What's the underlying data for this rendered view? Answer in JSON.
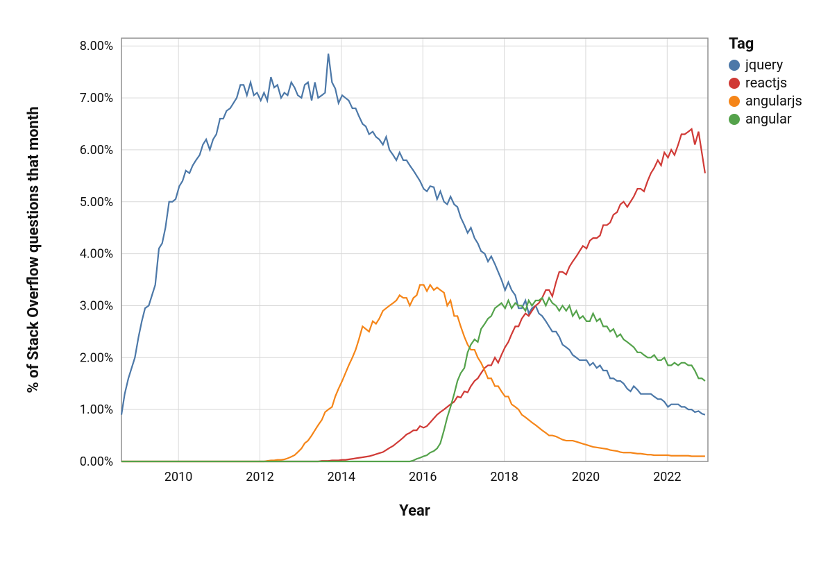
{
  "chart_data": {
    "type": "line",
    "title": "",
    "xlabel": "Year",
    "ylabel": "% of Stack Overflow questions that month",
    "legend_title": "Tag",
    "legend_position": "right",
    "grid": true,
    "x_start": 2008.6,
    "x_end": 2023.0,
    "x_ticks": [
      2010,
      2012,
      2014,
      2016,
      2018,
      2020,
      2022
    ],
    "y_ticks": [
      0,
      1,
      2,
      3,
      4,
      5,
      6,
      7,
      8
    ],
    "y_tick_labels": [
      "0.00%",
      "1.00%",
      "2.00%",
      "3.00%",
      "4.00%",
      "5.00%",
      "6.00%",
      "7.00%",
      "8.00%"
    ],
    "ylim": [
      0,
      8.15
    ],
    "x_tick_labels": [
      "2010",
      "2012",
      "2014",
      "2016",
      "2018",
      "2020",
      "2022"
    ],
    "colors": {
      "jquery": "#4c78a8",
      "reactjs": "#d03a36",
      "angularjs": "#f58518",
      "angular": "#54a24b"
    },
    "x": [
      2008.6,
      2008.68,
      2008.77,
      2008.85,
      2008.93,
      2009.02,
      2009.1,
      2009.18,
      2009.27,
      2009.35,
      2009.43,
      2009.52,
      2009.6,
      2009.68,
      2009.77,
      2009.85,
      2009.93,
      2010.02,
      2010.1,
      2010.18,
      2010.27,
      2010.35,
      2010.43,
      2010.52,
      2010.6,
      2010.68,
      2010.77,
      2010.85,
      2010.93,
      2011.02,
      2011.1,
      2011.18,
      2011.27,
      2011.35,
      2011.43,
      2011.52,
      2011.6,
      2011.68,
      2011.77,
      2011.85,
      2011.93,
      2012.02,
      2012.1,
      2012.18,
      2012.27,
      2012.35,
      2012.43,
      2012.52,
      2012.6,
      2012.68,
      2012.77,
      2012.85,
      2012.93,
      2013.02,
      2013.1,
      2013.18,
      2013.27,
      2013.35,
      2013.43,
      2013.52,
      2013.6,
      2013.68,
      2013.77,
      2013.85,
      2013.93,
      2014.02,
      2014.1,
      2014.18,
      2014.27,
      2014.35,
      2014.43,
      2014.52,
      2014.6,
      2014.68,
      2014.77,
      2014.85,
      2014.93,
      2015.02,
      2015.1,
      2015.18,
      2015.27,
      2015.35,
      2015.43,
      2015.52,
      2015.6,
      2015.68,
      2015.77,
      2015.85,
      2015.93,
      2016.02,
      2016.1,
      2016.18,
      2016.27,
      2016.35,
      2016.43,
      2016.52,
      2016.6,
      2016.68,
      2016.77,
      2016.85,
      2016.93,
      2017.02,
      2017.1,
      2017.18,
      2017.27,
      2017.35,
      2017.43,
      2017.52,
      2017.6,
      2017.68,
      2017.77,
      2017.85,
      2017.93,
      2018.02,
      2018.1,
      2018.18,
      2018.27,
      2018.35,
      2018.43,
      2018.52,
      2018.6,
      2018.68,
      2018.77,
      2018.85,
      2018.93,
      2019.02,
      2019.1,
      2019.18,
      2019.27,
      2019.35,
      2019.43,
      2019.52,
      2019.6,
      2019.68,
      2019.77,
      2019.85,
      2019.93,
      2020.02,
      2020.1,
      2020.18,
      2020.27,
      2020.35,
      2020.43,
      2020.52,
      2020.6,
      2020.68,
      2020.77,
      2020.85,
      2020.93,
      2021.02,
      2021.1,
      2021.18,
      2021.27,
      2021.35,
      2021.43,
      2021.52,
      2021.6,
      2021.68,
      2021.77,
      2021.85,
      2021.93,
      2022.02,
      2022.1,
      2022.18,
      2022.27,
      2022.35,
      2022.43,
      2022.52,
      2022.6,
      2022.68,
      2022.77,
      2022.85,
      2022.93
    ],
    "series": [
      {
        "name": "jquery",
        "color": "#4c78a8",
        "values": [
          0.9,
          1.3,
          1.6,
          1.8,
          2.0,
          2.4,
          2.7,
          2.95,
          3.0,
          3.2,
          3.4,
          4.1,
          4.2,
          4.5,
          5.0,
          5.0,
          5.05,
          5.3,
          5.4,
          5.6,
          5.55,
          5.7,
          5.8,
          5.9,
          6.1,
          6.2,
          6.0,
          6.2,
          6.3,
          6.6,
          6.6,
          6.75,
          6.8,
          6.9,
          7.0,
          7.25,
          7.25,
          7.05,
          7.3,
          7.05,
          7.1,
          6.95,
          7.1,
          6.95,
          7.4,
          7.2,
          7.25,
          7.0,
          7.1,
          7.05,
          7.3,
          7.2,
          7.05,
          7.0,
          7.25,
          7.3,
          6.95,
          7.3,
          7.0,
          7.05,
          7.1,
          7.85,
          7.3,
          7.18,
          6.9,
          7.05,
          7.0,
          6.95,
          6.8,
          6.8,
          6.65,
          6.5,
          6.45,
          6.3,
          6.35,
          6.25,
          6.2,
          6.1,
          6.25,
          6.0,
          5.9,
          5.8,
          5.95,
          5.8,
          5.8,
          5.7,
          5.6,
          5.5,
          5.4,
          5.25,
          5.2,
          5.3,
          5.28,
          5.05,
          5.2,
          5.0,
          4.95,
          5.1,
          4.95,
          4.9,
          4.7,
          4.55,
          4.4,
          4.5,
          4.3,
          4.2,
          4.05,
          4.0,
          3.85,
          3.95,
          3.8,
          3.65,
          3.5,
          3.3,
          3.45,
          3.3,
          3.2,
          2.95,
          2.95,
          3.1,
          2.85,
          2.95,
          3.0,
          2.85,
          2.8,
          2.7,
          2.6,
          2.5,
          2.5,
          2.4,
          2.25,
          2.2,
          2.15,
          2.05,
          2.0,
          1.95,
          1.95,
          1.95,
          1.85,
          1.9,
          1.8,
          1.85,
          1.75,
          1.75,
          1.6,
          1.6,
          1.55,
          1.55,
          1.5,
          1.4,
          1.35,
          1.45,
          1.38,
          1.3,
          1.3,
          1.3,
          1.3,
          1.25,
          1.2,
          1.2,
          1.15,
          1.05,
          1.1,
          1.1,
          1.1,
          1.05,
          1.05,
          1.0,
          1.0,
          0.95,
          0.97,
          0.92,
          0.9
        ]
      },
      {
        "name": "reactjs",
        "color": "#d03a36",
        "values": [
          0,
          0,
          0,
          0,
          0,
          0,
          0,
          0,
          0,
          0,
          0,
          0,
          0,
          0,
          0,
          0,
          0,
          0,
          0,
          0,
          0,
          0,
          0,
          0,
          0,
          0,
          0,
          0,
          0,
          0,
          0,
          0,
          0,
          0,
          0,
          0,
          0,
          0,
          0,
          0,
          0,
          0,
          0,
          0,
          0,
          0,
          0,
          0,
          0,
          0,
          0,
          0,
          0,
          0,
          0,
          0,
          0,
          0,
          0,
          0.01,
          0.01,
          0.01,
          0.02,
          0.02,
          0.02,
          0.03,
          0.03,
          0.04,
          0.05,
          0.06,
          0.07,
          0.08,
          0.09,
          0.1,
          0.12,
          0.14,
          0.16,
          0.18,
          0.22,
          0.26,
          0.3,
          0.35,
          0.4,
          0.46,
          0.52,
          0.55,
          0.6,
          0.6,
          0.68,
          0.65,
          0.68,
          0.75,
          0.83,
          0.9,
          0.95,
          1.0,
          1.05,
          1.1,
          1.15,
          1.25,
          1.23,
          1.35,
          1.33,
          1.45,
          1.55,
          1.6,
          1.7,
          1.8,
          1.85,
          1.85,
          2.0,
          1.9,
          2.05,
          2.2,
          2.3,
          2.45,
          2.6,
          2.6,
          2.75,
          2.85,
          2.8,
          2.9,
          3.0,
          3.05,
          3.15,
          3.3,
          3.3,
          3.18,
          3.45,
          3.65,
          3.65,
          3.6,
          3.75,
          3.85,
          3.95,
          4.05,
          4.15,
          4.1,
          4.25,
          4.3,
          4.3,
          4.35,
          4.55,
          4.55,
          4.6,
          4.75,
          4.8,
          4.95,
          5.0,
          4.9,
          5.0,
          5.1,
          5.25,
          5.25,
          5.2,
          5.4,
          5.55,
          5.65,
          5.8,
          5.7,
          5.95,
          5.85,
          6.0,
          5.9,
          6.1,
          6.3,
          6.3,
          6.35,
          6.4,
          6.1,
          6.35,
          5.95,
          5.55
        ]
      },
      {
        "name": "angularjs",
        "color": "#f58518",
        "values": [
          0,
          0,
          0,
          0,
          0,
          0,
          0,
          0,
          0,
          0,
          0,
          0,
          0,
          0,
          0,
          0,
          0,
          0,
          0,
          0,
          0,
          0,
          0,
          0,
          0,
          0,
          0,
          0,
          0,
          0,
          0,
          0,
          0,
          0,
          0,
          0,
          0,
          0,
          0,
          0,
          0,
          0,
          0,
          0.01,
          0.02,
          0.02,
          0.03,
          0.03,
          0.04,
          0.06,
          0.09,
          0.12,
          0.18,
          0.25,
          0.35,
          0.4,
          0.5,
          0.6,
          0.7,
          0.8,
          0.95,
          1.0,
          1.05,
          1.25,
          1.4,
          1.55,
          1.7,
          1.85,
          2.0,
          2.15,
          2.35,
          2.6,
          2.55,
          2.5,
          2.7,
          2.65,
          2.75,
          2.9,
          2.95,
          3.0,
          3.05,
          3.1,
          3.2,
          3.15,
          3.15,
          3.0,
          3.15,
          3.2,
          3.4,
          3.4,
          3.28,
          3.4,
          3.3,
          3.35,
          3.3,
          3.25,
          3.0,
          3.1,
          2.8,
          2.8,
          2.6,
          2.4,
          2.25,
          2.15,
          2.15,
          2.0,
          1.9,
          1.75,
          1.6,
          1.6,
          1.45,
          1.45,
          1.35,
          1.25,
          1.25,
          1.1,
          1.05,
          1.0,
          0.9,
          0.85,
          0.8,
          0.75,
          0.7,
          0.65,
          0.6,
          0.55,
          0.5,
          0.5,
          0.48,
          0.45,
          0.42,
          0.4,
          0.4,
          0.4,
          0.38,
          0.36,
          0.34,
          0.32,
          0.3,
          0.28,
          0.27,
          0.26,
          0.25,
          0.24,
          0.22,
          0.21,
          0.2,
          0.18,
          0.17,
          0.17,
          0.17,
          0.16,
          0.15,
          0.15,
          0.14,
          0.13,
          0.13,
          0.12,
          0.12,
          0.12,
          0.12,
          0.12,
          0.11,
          0.11,
          0.11,
          0.11,
          0.11,
          0.11,
          0.1,
          0.1,
          0.1,
          0.1,
          0.1
        ]
      },
      {
        "name": "angular",
        "color": "#54a24b",
        "values": [
          0,
          0,
          0,
          0,
          0,
          0,
          0,
          0,
          0,
          0,
          0,
          0,
          0,
          0,
          0,
          0,
          0,
          0,
          0,
          0,
          0,
          0,
          0,
          0,
          0,
          0,
          0,
          0,
          0,
          0,
          0,
          0,
          0,
          0,
          0,
          0,
          0,
          0,
          0,
          0,
          0,
          0,
          0,
          0,
          0,
          0,
          0,
          0,
          0,
          0,
          0,
          0,
          0,
          0,
          0,
          0,
          0,
          0,
          0,
          0,
          0,
          0,
          0,
          0,
          0,
          0,
          0,
          0,
          0,
          0,
          0,
          0,
          0,
          0,
          0,
          0,
          0,
          0,
          0,
          0,
          0,
          0,
          0,
          0,
          0,
          0,
          0.02,
          0.05,
          0.07,
          0.1,
          0.12,
          0.17,
          0.2,
          0.25,
          0.35,
          0.6,
          0.85,
          1.05,
          1.3,
          1.55,
          1.7,
          1.8,
          2.1,
          2.25,
          2.35,
          2.3,
          2.55,
          2.65,
          2.75,
          2.8,
          2.95,
          3.0,
          3.05,
          2.95,
          3.1,
          2.95,
          3.05,
          3.0,
          3.0,
          2.9,
          3.1,
          3.0,
          3.1,
          3.1,
          3.15,
          3.0,
          3.15,
          3.05,
          3.0,
          2.9,
          3.0,
          2.9,
          3.0,
          2.8,
          2.9,
          2.75,
          2.8,
          2.7,
          2.7,
          2.85,
          2.7,
          2.75,
          2.6,
          2.6,
          2.5,
          2.55,
          2.4,
          2.45,
          2.35,
          2.3,
          2.25,
          2.2,
          2.1,
          2.1,
          2.05,
          2.0,
          2.0,
          2.05,
          1.95,
          1.95,
          2.0,
          1.85,
          1.85,
          1.9,
          1.85,
          1.9,
          1.9,
          1.85,
          1.85,
          1.75,
          1.6,
          1.6,
          1.55
        ]
      }
    ]
  }
}
